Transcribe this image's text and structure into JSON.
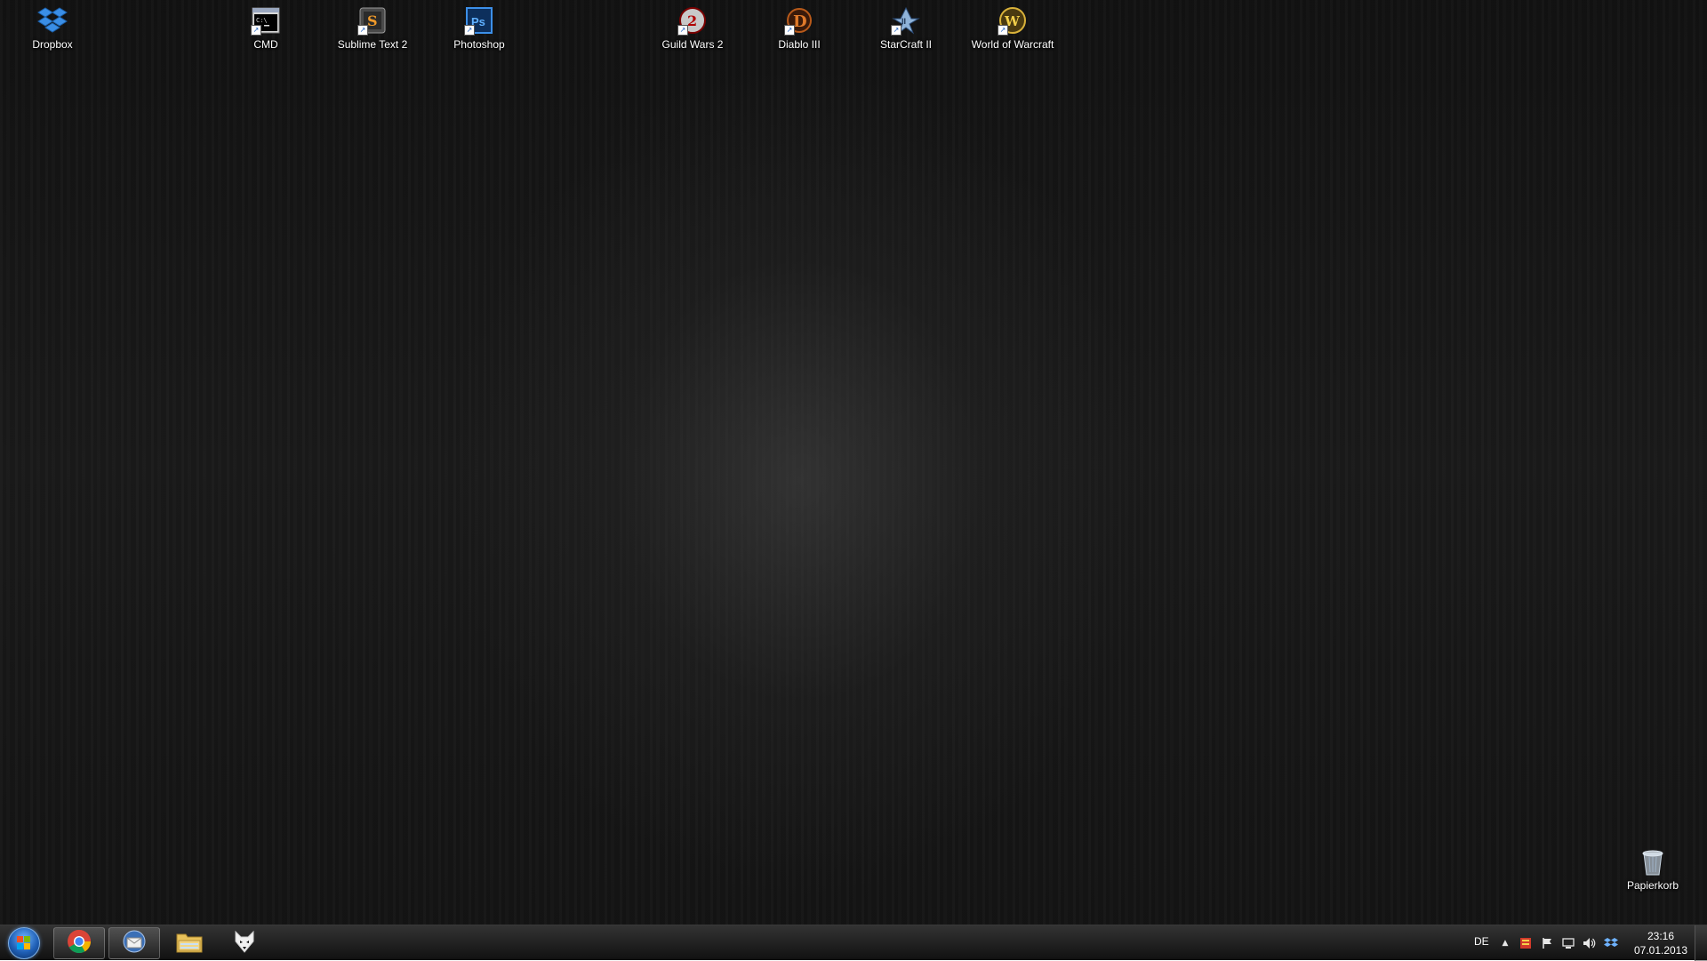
{
  "desktop": {
    "icons": [
      {
        "label": "Dropbox",
        "icon": "dropbox-icon"
      },
      {
        "label": "CMD",
        "icon": "cmd-icon"
      },
      {
        "label": "Sublime Text 2",
        "icon": "sublime-text-icon"
      },
      {
        "label": "Photoshop",
        "icon": "photoshop-icon"
      },
      {
        "label": "Guild Wars 2",
        "icon": "guild-wars-icon"
      },
      {
        "label": "Diablo III",
        "icon": "diablo-icon"
      },
      {
        "label": "StarCraft II",
        "icon": "starcraft-icon"
      },
      {
        "label": "World of Warcraft",
        "icon": "world-of-warcraft-icon"
      },
      {
        "label": "Papierkorb",
        "icon": "recycle-bin-icon"
      }
    ]
  },
  "taskbar": {
    "pinned": [
      {
        "icon": "chrome-icon"
      },
      {
        "icon": "thunderbird-icon"
      },
      {
        "icon": "file-explorer-icon"
      },
      {
        "icon": "foobar-icon"
      }
    ],
    "tray": {
      "language": "DE",
      "time": "23:16",
      "date": "07.01.2013"
    }
  },
  "colors": {
    "accent": "#1f5fb5",
    "label_text": "#ffffff",
    "photoshop": "#1e6ec8",
    "dropbox": "#3a8ee6"
  }
}
